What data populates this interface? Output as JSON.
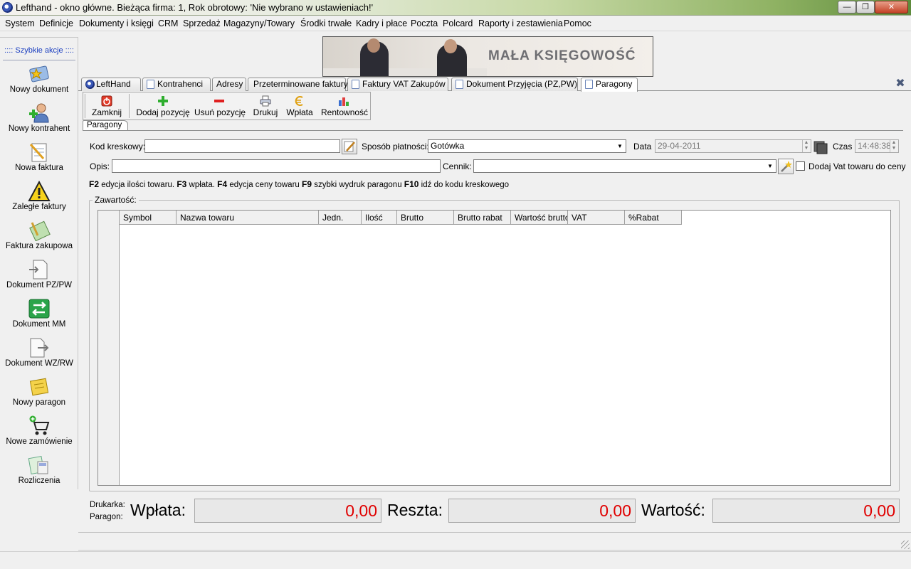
{
  "window": {
    "title": "Lefthand - okno główne. Bieżąca firma: 1, Rok obrotowy: 'Nie wybrano w ustawieniach!'",
    "min_glyph": "—",
    "max_glyph": "❐",
    "close_glyph": "✕"
  },
  "menu": [
    "System",
    "Definicje",
    "Dokumenty i księgi",
    "CRM",
    "Sprzedaż",
    "Magazyny/Towary",
    "Środki trwałe",
    "Kadry i płace",
    "Poczta",
    "Polcard",
    "Raporty i zestawienia",
    "Pomoc"
  ],
  "sidebar": {
    "title": ":::: Szybkie akcje ::::",
    "items": [
      {
        "label": "Nowy dokument",
        "icon": "new-document-icon"
      },
      {
        "label": "Nowy kontrahent",
        "icon": "new-contractor-icon"
      },
      {
        "label": "Nowa faktura",
        "icon": "new-invoice-icon"
      },
      {
        "label": "Zaległe faktury",
        "icon": "warning-icon"
      },
      {
        "label": "Faktura zakupowa",
        "icon": "purchase-invoice-icon"
      },
      {
        "label": "Dokument PZ/PW",
        "icon": "document-pz-icon"
      },
      {
        "label": "Dokument MM",
        "icon": "document-mm-icon"
      },
      {
        "label": "Dokument WZ/RW",
        "icon": "document-wz-icon"
      },
      {
        "label": "Nowy paragon",
        "icon": "receipt-icon"
      },
      {
        "label": "Nowe zamówienie",
        "icon": "cart-icon"
      },
      {
        "label": "Rozliczenia",
        "icon": "settlements-icon"
      }
    ]
  },
  "banner": {
    "text": "MAŁA KSIĘGOWOŚĆ"
  },
  "tabs": [
    {
      "label": "LeftHand",
      "active": false
    },
    {
      "label": "Kontrahenci",
      "active": false
    },
    {
      "label": "Adresy",
      "active": false
    },
    {
      "label": "Przeterminowane faktury",
      "active": false
    },
    {
      "label": "Faktury VAT Zakupów",
      "active": false
    },
    {
      "label": "Dokument Przyjęcia (PZ,PW)",
      "active": false
    },
    {
      "label": "Paragony",
      "active": true
    }
  ],
  "close_tab_glyph": "✖",
  "toolbar": {
    "close": "Zamknij",
    "add_item": "Dodaj pozycję",
    "remove_item": "Usuń pozycję",
    "print": "Drukuj",
    "payment": "Wpłata",
    "profitability": "Rentowność"
  },
  "subtab": "Paragony",
  "form": {
    "barcode_label": "Kod kreskowy:",
    "barcode_value": "",
    "payment_method_label": "Sposób płatności:",
    "payment_method_value": "Gotówka",
    "date_label": "Data",
    "date_value": "29-04-2011",
    "time_label": "Czas",
    "time_value": "14:48:38",
    "description_label": "Opis:",
    "description_value": "",
    "pricelist_label": "Cennik:",
    "pricelist_value": "",
    "add_vat_label": "Dodaj Vat towaru do ceny",
    "add_vat_checked": false
  },
  "hints": [
    {
      "key": "F2",
      "text": " edycja ilości towaru. "
    },
    {
      "key": "F3",
      "text": " wpłata. "
    },
    {
      "key": "F4",
      "text": " edycja ceny towaru "
    },
    {
      "key": "F9",
      "text": " szybki wydruk paragonu "
    },
    {
      "key": "F10",
      "text": " idź do kodu kreskowego"
    }
  ],
  "content_group": "Zawartość:",
  "grid": {
    "columns": [
      "Symbol",
      "Nazwa towaru",
      "Jedn.",
      "Ilość",
      "Brutto",
      "Brutto rabat",
      "Wartość brutto",
      "VAT",
      "%Rabat"
    ],
    "rows": []
  },
  "bottom": {
    "printer_label": "Drukarka:",
    "receipt_label": "Paragon:",
    "payment_label": "Wpłata:",
    "payment_value": "0,00",
    "change_label": "Reszta:",
    "change_value": "0,00",
    "value_label": "Wartość:",
    "value_value": "0,00"
  },
  "colors": {
    "amount_red": "#e00000",
    "sidebar_title_blue": "#1a3ec0"
  }
}
